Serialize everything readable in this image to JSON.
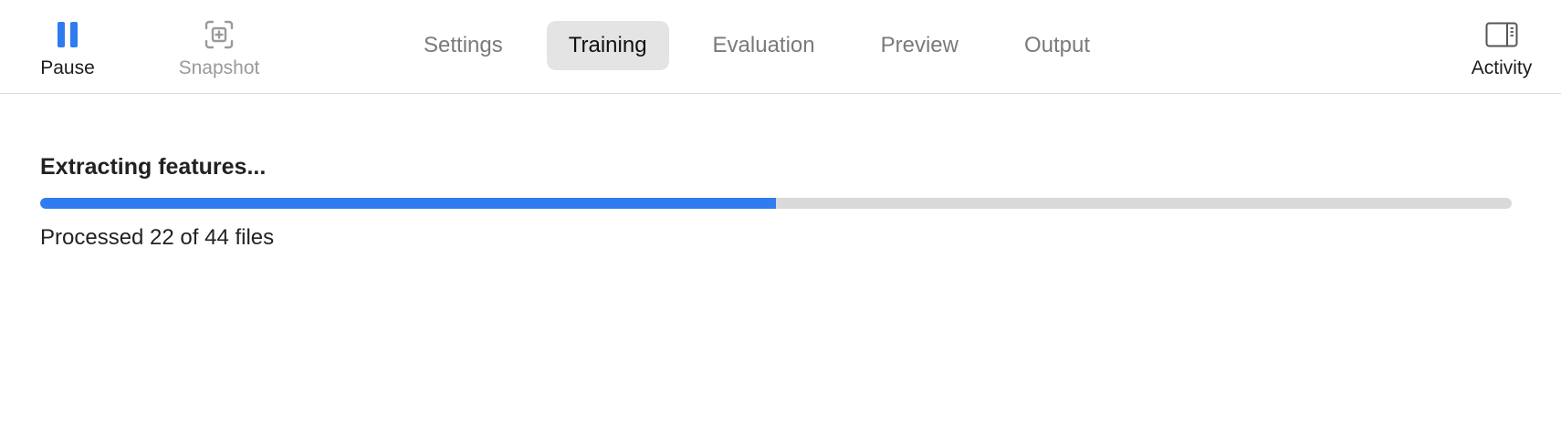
{
  "toolbar": {
    "pause": {
      "label": "Pause",
      "icon": "pause-icon"
    },
    "snapshot": {
      "label": "Snapshot",
      "icon": "snapshot-icon",
      "enabled": false
    },
    "activity": {
      "label": "Activity",
      "icon": "sidebar-panel-icon"
    }
  },
  "tabs": [
    {
      "label": "Settings",
      "active": false
    },
    {
      "label": "Training",
      "active": true
    },
    {
      "label": "Evaluation",
      "active": false
    },
    {
      "label": "Preview",
      "active": false
    },
    {
      "label": "Output",
      "active": false
    }
  ],
  "status": {
    "title": "Extracting features...",
    "caption": "Processed 22 of 44 files",
    "processed": 22,
    "total": 44,
    "progress_fraction": 0.5
  },
  "colors": {
    "accent": "#2f7bf0",
    "track": "#d9d9d9",
    "active_tab_bg": "#e4e4e4"
  }
}
